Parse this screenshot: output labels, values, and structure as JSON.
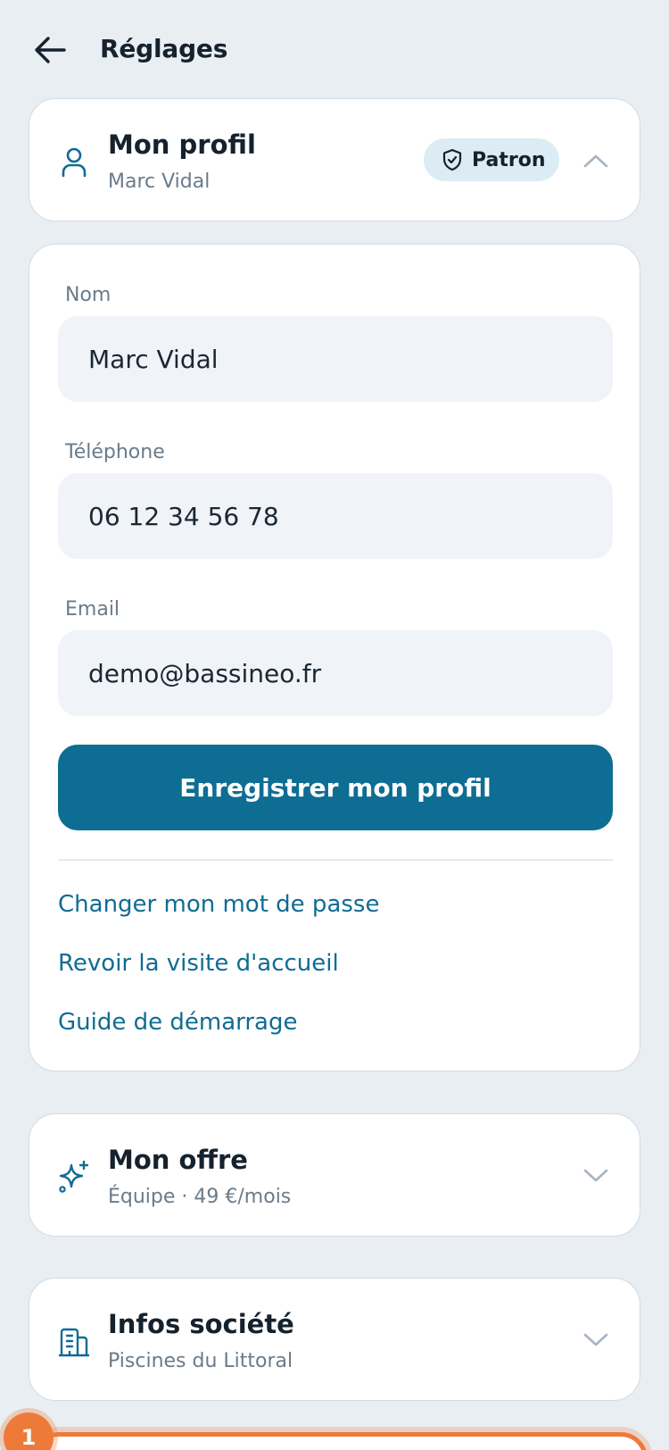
{
  "header": {
    "title": "Réglages"
  },
  "profile": {
    "title": "Mon profil",
    "subtitle": "Marc Vidal",
    "badge": "Patron",
    "fields": {
      "name": {
        "label": "Nom",
        "value": "Marc Vidal"
      },
      "phone": {
        "label": "Téléphone",
        "value": "06 12 34 56 78"
      },
      "email": {
        "label": "Email",
        "value": "demo@bassineo.fr"
      }
    },
    "save_label": "Enregistrer mon profil",
    "links": {
      "password": "Changer mon mot de passe",
      "tour": "Revoir la visite d'accueil",
      "guide": "Guide de démarrage"
    }
  },
  "offer": {
    "title": "Mon offre",
    "subtitle": "Équipe · 49 €/mois"
  },
  "company": {
    "title": "Infos société",
    "subtitle": "Piscines du Littoral"
  },
  "step_badge": "1",
  "colors": {
    "accent": "#0e6d93",
    "background": "#e9eef3",
    "highlight": "#ee7a3a"
  }
}
